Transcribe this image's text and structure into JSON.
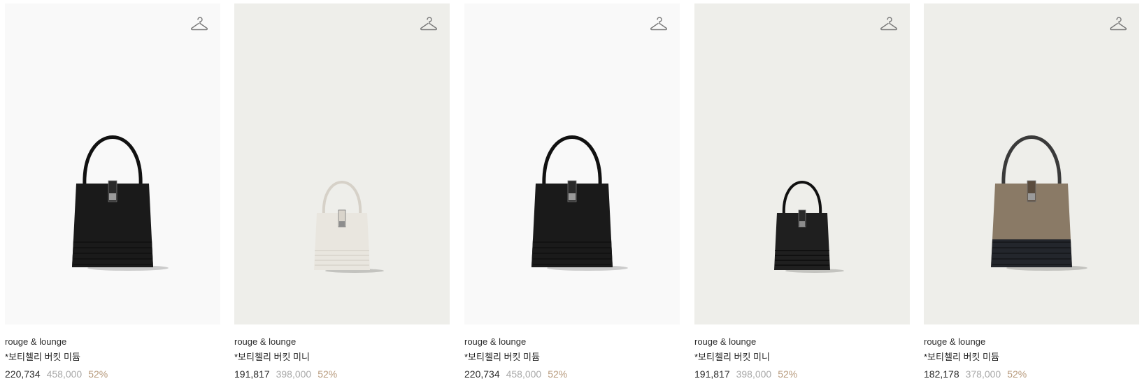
{
  "colors": {
    "accent_discount": "#b79a7c",
    "original_price": "#a9a9a9"
  },
  "icons": {
    "wishlist": "hanger-icon"
  },
  "products": [
    {
      "brand": "rouge & lounge",
      "name": "*보티첼리 버킷 미듐",
      "sale_price": "220,734",
      "original_price": "458,000",
      "discount": "52%",
      "bg": "#f9f9f9",
      "bag": {
        "color": "#1a1a1a",
        "size": "medium"
      }
    },
    {
      "brand": "rouge & lounge",
      "name": "*보티첼리 버킷 미니",
      "sale_price": "191,817",
      "original_price": "398,000",
      "discount": "52%",
      "bg": "#eeeeea",
      "bag": {
        "color": "#e9e6df",
        "size": "mini"
      }
    },
    {
      "brand": "rouge & lounge",
      "name": "*보티첼리 버킷 미듐",
      "sale_price": "220,734",
      "original_price": "458,000",
      "discount": "52%",
      "bg": "#f9f9f9",
      "bag": {
        "color": "#1a1a1a",
        "size": "medium"
      }
    },
    {
      "brand": "rouge & lounge",
      "name": "*보티첼리 버킷 미니",
      "sale_price": "191,817",
      "original_price": "398,000",
      "discount": "52%",
      "bg": "#eeeeea",
      "bag": {
        "color": "#1f1f1f",
        "size": "mini"
      }
    },
    {
      "brand": "rouge & lounge",
      "name": "*보티첼리 버킷 미듐",
      "sale_price": "182,178",
      "original_price": "378,000",
      "discount": "52%",
      "bg": "#eeeeea",
      "bag": {
        "color": "#8a7a66",
        "size": "medium-tweed"
      }
    }
  ]
}
